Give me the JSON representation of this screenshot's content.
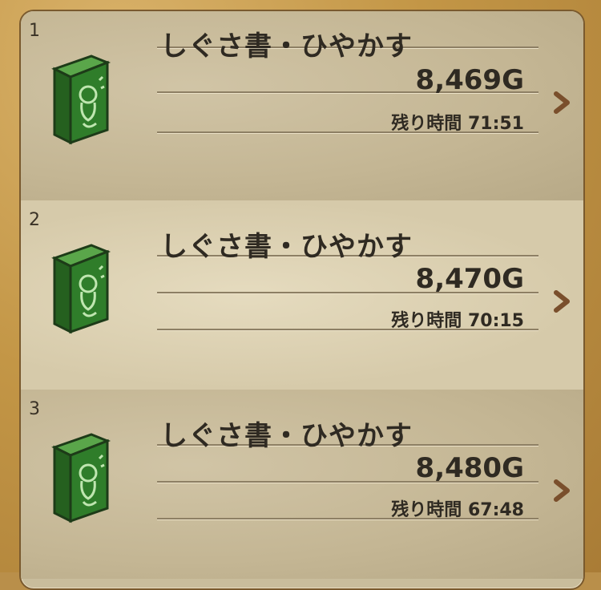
{
  "items": [
    {
      "rank": "1",
      "name": "しぐさ書・ひやかす",
      "price": "8,469G",
      "remain": "残り時間 71:51"
    },
    {
      "rank": "2",
      "name": "しぐさ書・ひやかす",
      "price": "8,470G",
      "remain": "残り時間 70:15"
    },
    {
      "rank": "3",
      "name": "しぐさ書・ひやかす",
      "price": "8,480G",
      "remain": "残り時間 67:48"
    }
  ],
  "colors": {
    "book_green": "#2f7d2a",
    "panel": "#c9bd9c",
    "frame": "#b98f4a",
    "text": "#2f2a22"
  },
  "icons": [
    "book-icon",
    "chevron-right-icon"
  ]
}
